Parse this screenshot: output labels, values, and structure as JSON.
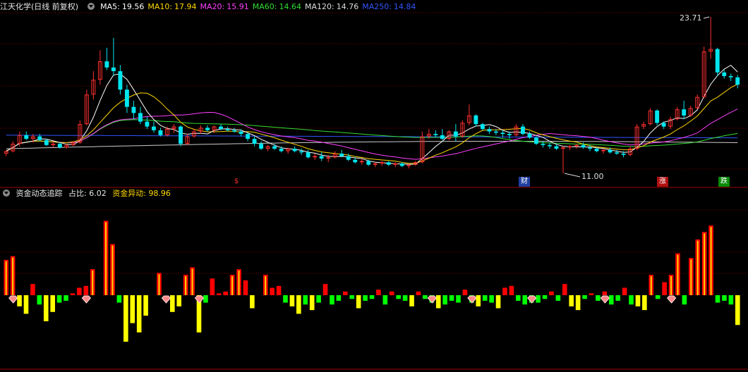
{
  "main_header": {
    "title": "江天化学(日线 前复权)",
    "ma": [
      {
        "label": "MA5:",
        "value": "19.56",
        "color": "#ffffff"
      },
      {
        "label": "MA10:",
        "value": "17.94",
        "color": "#ffd700"
      },
      {
        "label": "MA20:",
        "value": "15.91",
        "color": "#ff40ff"
      },
      {
        "label": "MA60:",
        "value": "14.64",
        "color": "#33dd33"
      },
      {
        "label": "MA120:",
        "value": "14.76",
        "color": "#dddddd"
      },
      {
        "label": "MA250:",
        "value": "14.84",
        "color": "#3355ff"
      }
    ]
  },
  "sub_header": {
    "title": "资金动态追踪",
    "ratio_label": "占比:",
    "ratio_value": "6.02",
    "flow_label": "资金异动:",
    "flow_value": "98.96"
  },
  "annotations": {
    "high_label": "23.71",
    "low_label": "11.00",
    "tags": [
      "$",
      "财",
      "涨",
      "跌"
    ]
  },
  "colors": {
    "up": "#ff3030",
    "down": "#00e5ee",
    "grid": "#7a0000",
    "bar_pos": "#ff0000",
    "bar_pos_alt": "#ffd700",
    "bar_neg_yellow": "#ffff00",
    "bar_neg_green": "#00ff00"
  },
  "chart_data": {
    "type": "candlestick",
    "price_scale": [
      11.0,
      23.71
    ],
    "candles": [
      [
        12.6,
        12.9,
        12.4,
        12.8
      ],
      [
        12.8,
        13.6,
        12.7,
        13.4
      ],
      [
        13.4,
        14.4,
        13.2,
        14.1
      ],
      [
        14.1,
        14.4,
        13.7,
        13.8
      ],
      [
        13.8,
        14.2,
        13.5,
        14.0
      ],
      [
        14.0,
        14.2,
        13.6,
        13.7
      ],
      [
        13.7,
        13.8,
        13.2,
        13.3
      ],
      [
        13.3,
        13.6,
        13.1,
        13.4
      ],
      [
        13.4,
        13.5,
        13.0,
        13.1
      ],
      [
        13.1,
        13.4,
        13.0,
        13.3
      ],
      [
        13.3,
        13.6,
        13.2,
        13.5
      ],
      [
        13.5,
        15.3,
        13.4,
        15.0
      ],
      [
        15.0,
        17.8,
        14.9,
        17.4
      ],
      [
        17.4,
        19.3,
        17.0,
        18.6
      ],
      [
        18.6,
        21.0,
        18.2,
        20.1
      ],
      [
        20.1,
        21.2,
        19.4,
        19.6
      ],
      [
        19.6,
        22.0,
        18.9,
        19.3
      ],
      [
        19.3,
        19.8,
        17.4,
        17.8
      ],
      [
        17.8,
        18.2,
        15.9,
        16.4
      ],
      [
        16.4,
        16.9,
        15.4,
        15.9
      ],
      [
        15.9,
        16.4,
        15.0,
        15.2
      ],
      [
        15.2,
        15.6,
        14.6,
        14.8
      ],
      [
        14.8,
        15.2,
        14.3,
        14.5
      ],
      [
        14.5,
        14.7,
        14.0,
        14.1
      ],
      [
        14.1,
        14.8,
        14.0,
        14.6
      ],
      [
        14.6,
        15.0,
        14.3,
        14.8
      ],
      [
        14.8,
        14.9,
        13.2,
        13.4
      ],
      [
        13.4,
        14.2,
        13.3,
        14.0
      ],
      [
        14.0,
        14.6,
        13.9,
        14.4
      ],
      [
        14.4,
        14.9,
        14.2,
        14.7
      ],
      [
        14.7,
        14.9,
        14.4,
        14.5
      ],
      [
        14.5,
        14.9,
        14.3,
        14.8
      ],
      [
        14.8,
        15.0,
        14.5,
        14.6
      ],
      [
        14.6,
        14.8,
        14.4,
        14.5
      ],
      [
        14.5,
        14.7,
        14.3,
        14.4
      ],
      [
        14.4,
        14.6,
        14.0,
        14.2
      ],
      [
        14.2,
        14.3,
        13.6,
        13.8
      ],
      [
        13.8,
        14.0,
        13.2,
        13.4
      ],
      [
        13.4,
        13.6,
        12.9,
        13.0
      ],
      [
        13.0,
        13.3,
        12.8,
        13.2
      ],
      [
        13.2,
        13.4,
        12.9,
        13.0
      ],
      [
        13.0,
        13.2,
        12.7,
        12.8
      ],
      [
        12.8,
        13.1,
        12.6,
        13.0
      ],
      [
        13.0,
        13.2,
        12.7,
        12.8
      ],
      [
        12.8,
        13.0,
        12.5,
        12.7
      ],
      [
        12.7,
        12.9,
        12.2,
        12.3
      ],
      [
        12.3,
        12.6,
        12.1,
        12.4
      ],
      [
        12.4,
        12.7,
        12.0,
        12.2
      ],
      [
        12.2,
        12.5,
        11.9,
        12.3
      ],
      [
        12.3,
        12.8,
        12.2,
        12.6
      ],
      [
        12.6,
        12.9,
        12.3,
        12.4
      ],
      [
        12.4,
        12.6,
        12.0,
        12.1
      ],
      [
        12.1,
        12.3,
        11.8,
        11.9
      ],
      [
        11.9,
        12.2,
        11.7,
        12.0
      ],
      [
        12.0,
        12.1,
        11.6,
        11.7
      ],
      [
        11.7,
        11.9,
        11.5,
        11.8
      ],
      [
        11.8,
        12.0,
        11.6,
        11.9
      ],
      [
        11.9,
        12.0,
        11.6,
        11.7
      ],
      [
        11.7,
        11.9,
        11.5,
        11.8
      ],
      [
        11.8,
        11.9,
        11.5,
        11.6
      ],
      [
        11.6,
        11.8,
        11.4,
        11.7
      ],
      [
        11.7,
        12.0,
        11.6,
        11.9
      ],
      [
        11.9,
        14.4,
        11.8,
        14.0
      ],
      [
        14.0,
        14.6,
        13.8,
        14.2
      ],
      [
        14.2,
        14.5,
        13.9,
        14.1
      ],
      [
        14.1,
        14.6,
        13.7,
        13.8
      ],
      [
        13.8,
        14.5,
        13.7,
        14.4
      ],
      [
        14.4,
        15.0,
        13.6,
        14.0
      ],
      [
        14.0,
        15.3,
        13.9,
        15.1
      ],
      [
        15.1,
        16.6,
        14.9,
        15.7
      ],
      [
        15.7,
        15.8,
        14.8,
        15.0
      ],
      [
        15.0,
        15.1,
        14.5,
        14.6
      ],
      [
        14.6,
        14.8,
        14.2,
        14.4
      ],
      [
        14.4,
        14.6,
        14.1,
        14.3
      ],
      [
        14.3,
        14.5,
        13.9,
        14.2
      ],
      [
        14.2,
        14.4,
        13.8,
        14.1
      ],
      [
        14.1,
        15.0,
        14.0,
        14.8
      ],
      [
        14.8,
        15.0,
        14.1,
        14.2
      ],
      [
        14.2,
        14.4,
        13.8,
        13.9
      ],
      [
        13.9,
        14.0,
        13.3,
        13.4
      ],
      [
        13.4,
        13.6,
        13.1,
        13.3
      ],
      [
        13.3,
        13.5,
        13.0,
        13.2
      ],
      [
        13.2,
        13.4,
        12.9,
        13.0
      ],
      [
        13.0,
        13.2,
        11.0,
        13.1
      ],
      [
        13.1,
        13.3,
        12.9,
        13.2
      ],
      [
        13.2,
        13.4,
        13.0,
        13.3
      ],
      [
        13.3,
        13.5,
        13.0,
        13.1
      ],
      [
        13.1,
        13.3,
        12.8,
        13.0
      ],
      [
        13.0,
        13.1,
        12.7,
        12.8
      ],
      [
        12.8,
        13.0,
        12.6,
        12.9
      ],
      [
        12.9,
        13.1,
        12.6,
        12.7
      ],
      [
        12.7,
        12.9,
        12.5,
        12.6
      ],
      [
        12.6,
        12.8,
        12.3,
        12.5
      ],
      [
        12.5,
        13.2,
        12.4,
        13.0
      ],
      [
        13.0,
        15.0,
        12.9,
        14.8
      ],
      [
        14.8,
        15.2,
        14.6,
        15.0
      ],
      [
        15.0,
        16.3,
        14.9,
        16.1
      ],
      [
        16.1,
        16.2,
        14.9,
        15.1
      ],
      [
        15.1,
        15.2,
        14.6,
        14.8
      ],
      [
        14.8,
        15.6,
        14.6,
        15.4
      ],
      [
        15.4,
        16.4,
        15.3,
        16.2
      ],
      [
        16.2,
        16.9,
        15.4,
        15.7
      ],
      [
        15.7,
        16.5,
        15.6,
        16.3
      ],
      [
        16.3,
        17.4,
        16.2,
        17.2
      ],
      [
        17.2,
        21.3,
        17.1,
        20.9
      ],
      [
        20.9,
        23.71,
        20.3,
        21.1
      ],
      [
        21.1,
        21.2,
        18.9,
        19.2
      ],
      [
        19.2,
        19.4,
        18.7,
        18.9
      ],
      [
        18.9,
        19.1,
        18.5,
        18.8
      ],
      [
        18.8,
        19.0,
        17.9,
        18.2
      ]
    ],
    "money_flow": [
      38,
      42,
      -12,
      -20,
      12,
      -10,
      -28,
      -18,
      -8,
      -6,
      2,
      8,
      10,
      28,
      0,
      80,
      55,
      -8,
      -50,
      -30,
      -40,
      -22,
      0,
      24,
      0,
      -18,
      -12,
      22,
      30,
      -40,
      -8,
      18,
      2,
      4,
      22,
      28,
      16,
      -14,
      0,
      22,
      8,
      10,
      -8,
      -12,
      -20,
      -10,
      -16,
      -8,
      12,
      -10,
      -6,
      4,
      -4,
      -14,
      -6,
      -4,
      6,
      -10,
      4,
      -4,
      -6,
      -12,
      4,
      -4,
      -8,
      -14,
      -10,
      -6,
      -8,
      6,
      -8,
      -12,
      -6,
      -8,
      -14,
      8,
      10,
      -6,
      -10,
      -8,
      -8,
      -4,
      4,
      -6,
      12,
      -12,
      -16,
      -4,
      2,
      -6,
      4,
      -10,
      -6,
      8,
      -10,
      -12,
      -16,
      22,
      -4,
      14,
      22,
      45,
      -10,
      40,
      60,
      68,
      75,
      -8,
      -6,
      -10,
      -32
    ],
    "diamond_indices": [
      0,
      11,
      23,
      28,
      63,
      69,
      78,
      89,
      99
    ],
    "dollar_marker_index": 35
  }
}
